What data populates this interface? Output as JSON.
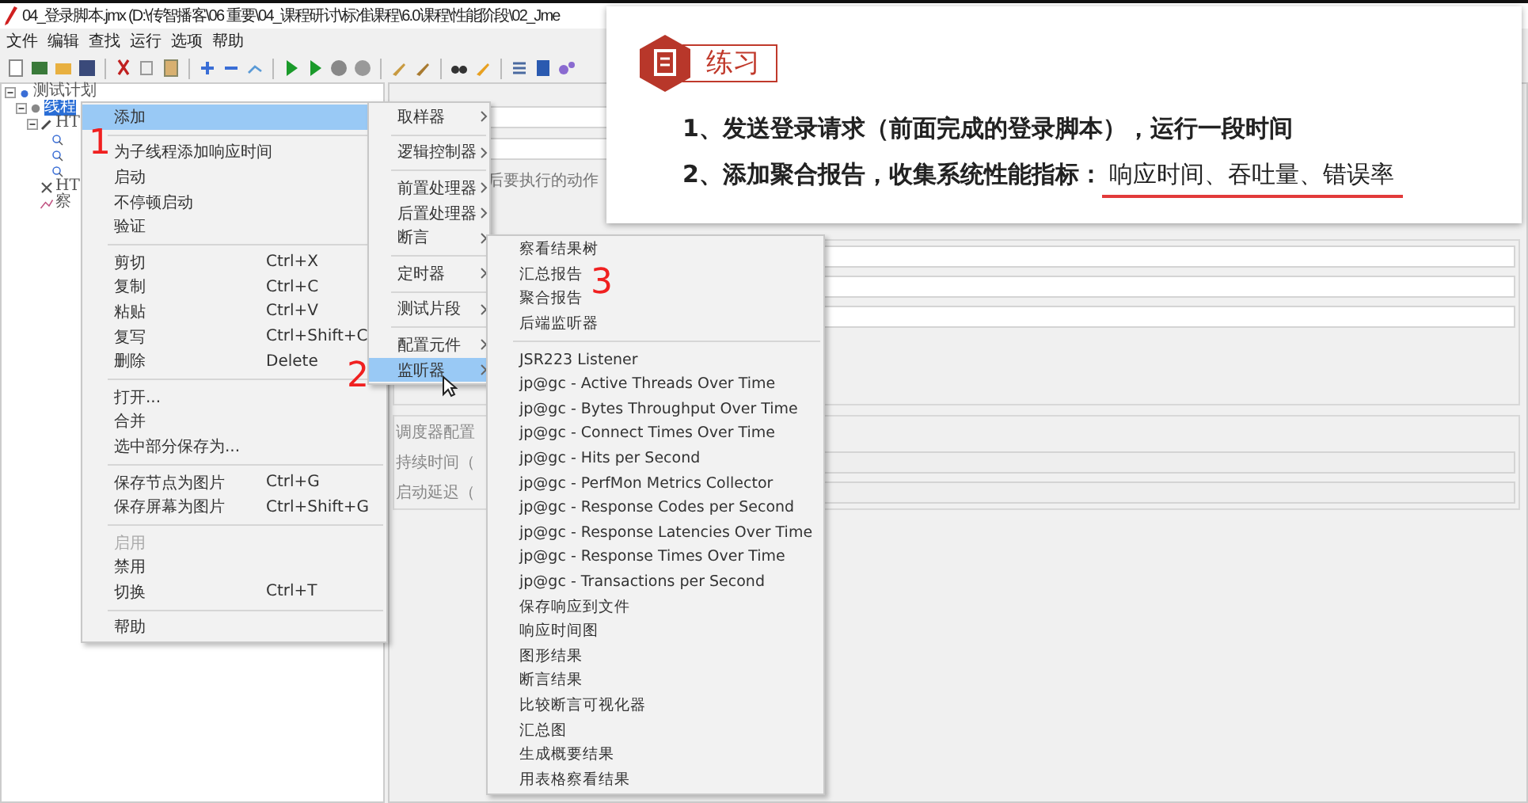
{
  "window": {
    "title": "04_登录脚本.jmx (D:\\传智播客\\06 重要\\04_课程研讨\\标准课程\\6.0课程\\性能阶段\\02_Jme"
  },
  "menu_bar": [
    "文件",
    "编辑",
    "查找",
    "运行",
    "选项",
    "帮助"
  ],
  "tree": [
    {
      "label": "测试计划",
      "kind": "plan",
      "expanded": true,
      "selected": false,
      "children": [
        {
          "label": "线程",
          "kind": "group",
          "expanded": true,
          "selected": true,
          "children": [
            {
              "label": "HT",
              "kind": "sampler",
              "expanded": true,
              "selected": false,
              "children": [
                {
                  "kind": "covered"
                },
                {
                  "kind": "covered"
                },
                {
                  "kind": "covered"
                }
              ]
            },
            {
              "label": "HT",
              "kind": "config",
              "selected": false
            },
            {
              "label": "察",
              "kind": "listener",
              "selected": false
            }
          ]
        }
      ]
    }
  ],
  "panel": {
    "error_action": "后要执行的动作",
    "scheduler": {
      "title": "调度器配置",
      "fields": [
        "持续时间（",
        "启动延迟（"
      ]
    }
  },
  "context_menu": [
    [
      {
        "label": "添加",
        "selected": true,
        "disabled": false,
        "submenu": true
      }
    ],
    [
      {
        "label": "为子线程添加响应时间",
        "selected": false,
        "disabled": false,
        "submenu": false
      },
      {
        "label": "启动",
        "selected": false,
        "disabled": false,
        "submenu": false
      },
      {
        "label": "不停顿启动",
        "selected": false,
        "disabled": false,
        "submenu": false
      },
      {
        "label": "验证",
        "selected": false,
        "disabled": false,
        "submenu": false
      }
    ],
    [
      {
        "label": "剪切",
        "shortcut": "Ctrl+X",
        "selected": false,
        "disabled": false,
        "submenu": false
      },
      {
        "label": "复制",
        "shortcut": "Ctrl+C",
        "selected": false,
        "disabled": false,
        "submenu": false
      },
      {
        "label": "粘贴",
        "shortcut": "Ctrl+V",
        "selected": false,
        "disabled": false,
        "submenu": false
      },
      {
        "label": "复写",
        "shortcut": "Ctrl+Shift+C",
        "selected": false,
        "disabled": false,
        "submenu": false
      },
      {
        "label": "删除",
        "shortcut": "Delete",
        "selected": false,
        "disabled": false,
        "submenu": false
      }
    ],
    [
      {
        "label": "打开...",
        "selected": false,
        "disabled": false,
        "submenu": false
      },
      {
        "label": "合并",
        "selected": false,
        "disabled": false,
        "submenu": false
      },
      {
        "label": "选中部分保存为...",
        "selected": false,
        "disabled": false,
        "submenu": false
      }
    ],
    [
      {
        "label": "保存节点为图片",
        "shortcut": "Ctrl+G",
        "selected": false,
        "disabled": false,
        "submenu": false
      },
      {
        "label": "保存屏幕为图片",
        "shortcut": "Ctrl+Shift+G",
        "selected": false,
        "disabled": false,
        "submenu": false
      }
    ],
    [
      {
        "label": "启用",
        "selected": false,
        "disabled": true,
        "submenu": false
      },
      {
        "label": "禁用",
        "selected": false,
        "disabled": false,
        "submenu": false
      },
      {
        "label": "切换",
        "shortcut": "Ctrl+T",
        "selected": false,
        "disabled": false,
        "submenu": false
      }
    ],
    [
      {
        "label": "帮助",
        "selected": false,
        "disabled": false,
        "submenu": false
      }
    ]
  ],
  "add_submenu": [
    [
      {
        "label": "取样器",
        "selected": false,
        "disabled": false,
        "submenu": true
      }
    ],
    [
      {
        "label": "逻辑控制器",
        "selected": false,
        "disabled": false,
        "submenu": true
      }
    ],
    [
      {
        "label": "前置处理器",
        "selected": false,
        "disabled": false,
        "submenu": true
      },
      {
        "label": "后置处理器",
        "selected": false,
        "disabled": false,
        "submenu": true
      },
      {
        "label": "断言",
        "selected": false,
        "disabled": false,
        "submenu": true
      }
    ],
    [
      {
        "label": "定时器",
        "selected": false,
        "disabled": false,
        "submenu": true
      }
    ],
    [
      {
        "label": "测试片段",
        "selected": false,
        "disabled": false,
        "submenu": true
      }
    ],
    [
      {
        "label": "配置元件",
        "selected": false,
        "disabled": false,
        "submenu": true
      },
      {
        "label": "监听器",
        "selected": true,
        "disabled": false,
        "submenu": true
      }
    ]
  ],
  "listener_submenu": [
    [
      {
        "label": "察看结果树",
        "selected": false,
        "disabled": false,
        "submenu": false
      },
      {
        "label": "汇总报告",
        "selected": false,
        "disabled": false,
        "submenu": false
      },
      {
        "label": "聚合报告",
        "selected": false,
        "disabled": false,
        "submenu": false
      },
      {
        "label": "后端监听器",
        "selected": false,
        "disabled": false,
        "submenu": false
      }
    ],
    [
      {
        "label": "JSR223 Listener",
        "selected": false,
        "disabled": false,
        "submenu": false
      },
      {
        "label": "jp@gc - Active Threads Over Time",
        "selected": false,
        "disabled": false,
        "submenu": false
      },
      {
        "label": "jp@gc - Bytes Throughput Over Time",
        "selected": false,
        "disabled": false,
        "submenu": false
      },
      {
        "label": "jp@gc - Connect Times Over Time",
        "selected": false,
        "disabled": false,
        "submenu": false
      },
      {
        "label": "jp@gc - Hits per Second",
        "selected": false,
        "disabled": false,
        "submenu": false
      },
      {
        "label": "jp@gc - PerfMon Metrics Collector",
        "selected": false,
        "disabled": false,
        "submenu": false
      },
      {
        "label": "jp@gc - Response Codes per Second",
        "selected": false,
        "disabled": false,
        "submenu": false
      },
      {
        "label": "jp@gc - Response Latencies Over Time",
        "selected": false,
        "disabled": false,
        "submenu": false
      },
      {
        "label": "jp@gc - Response Times Over Time",
        "selected": false,
        "disabled": false,
        "submenu": false
      },
      {
        "label": "jp@gc - Transactions per Second",
        "selected": false,
        "disabled": false,
        "submenu": false
      },
      {
        "label": "保存响应到文件",
        "selected": false,
        "disabled": false,
        "submenu": false
      },
      {
        "label": "响应时间图",
        "selected": false,
        "disabled": false,
        "submenu": false
      },
      {
        "label": "图形结果",
        "selected": false,
        "disabled": false,
        "submenu": false
      },
      {
        "label": "断言结果",
        "selected": false,
        "disabled": false,
        "submenu": false
      },
      {
        "label": "比较断言可视化器",
        "selected": false,
        "disabled": false,
        "submenu": false
      },
      {
        "label": "汇总图",
        "selected": false,
        "disabled": false,
        "submenu": false
      },
      {
        "label": "生成概要结果",
        "selected": false,
        "disabled": false,
        "submenu": false
      },
      {
        "label": "用表格察看结果",
        "selected": false,
        "disabled": false,
        "submenu": false
      }
    ]
  ],
  "slide": {
    "title": "练习",
    "items": [
      {
        "text": "1、发送登录请求（前面完成的登录脚本），运行一段时间"
      },
      {
        "text": "2、添加聚合报告，收集系统性能指标：",
        "underlined": "响应时间、吞吐量、错误率"
      }
    ]
  },
  "annotations": [
    {
      "text": "1"
    },
    {
      "text": "2"
    },
    {
      "text": "3"
    }
  ]
}
